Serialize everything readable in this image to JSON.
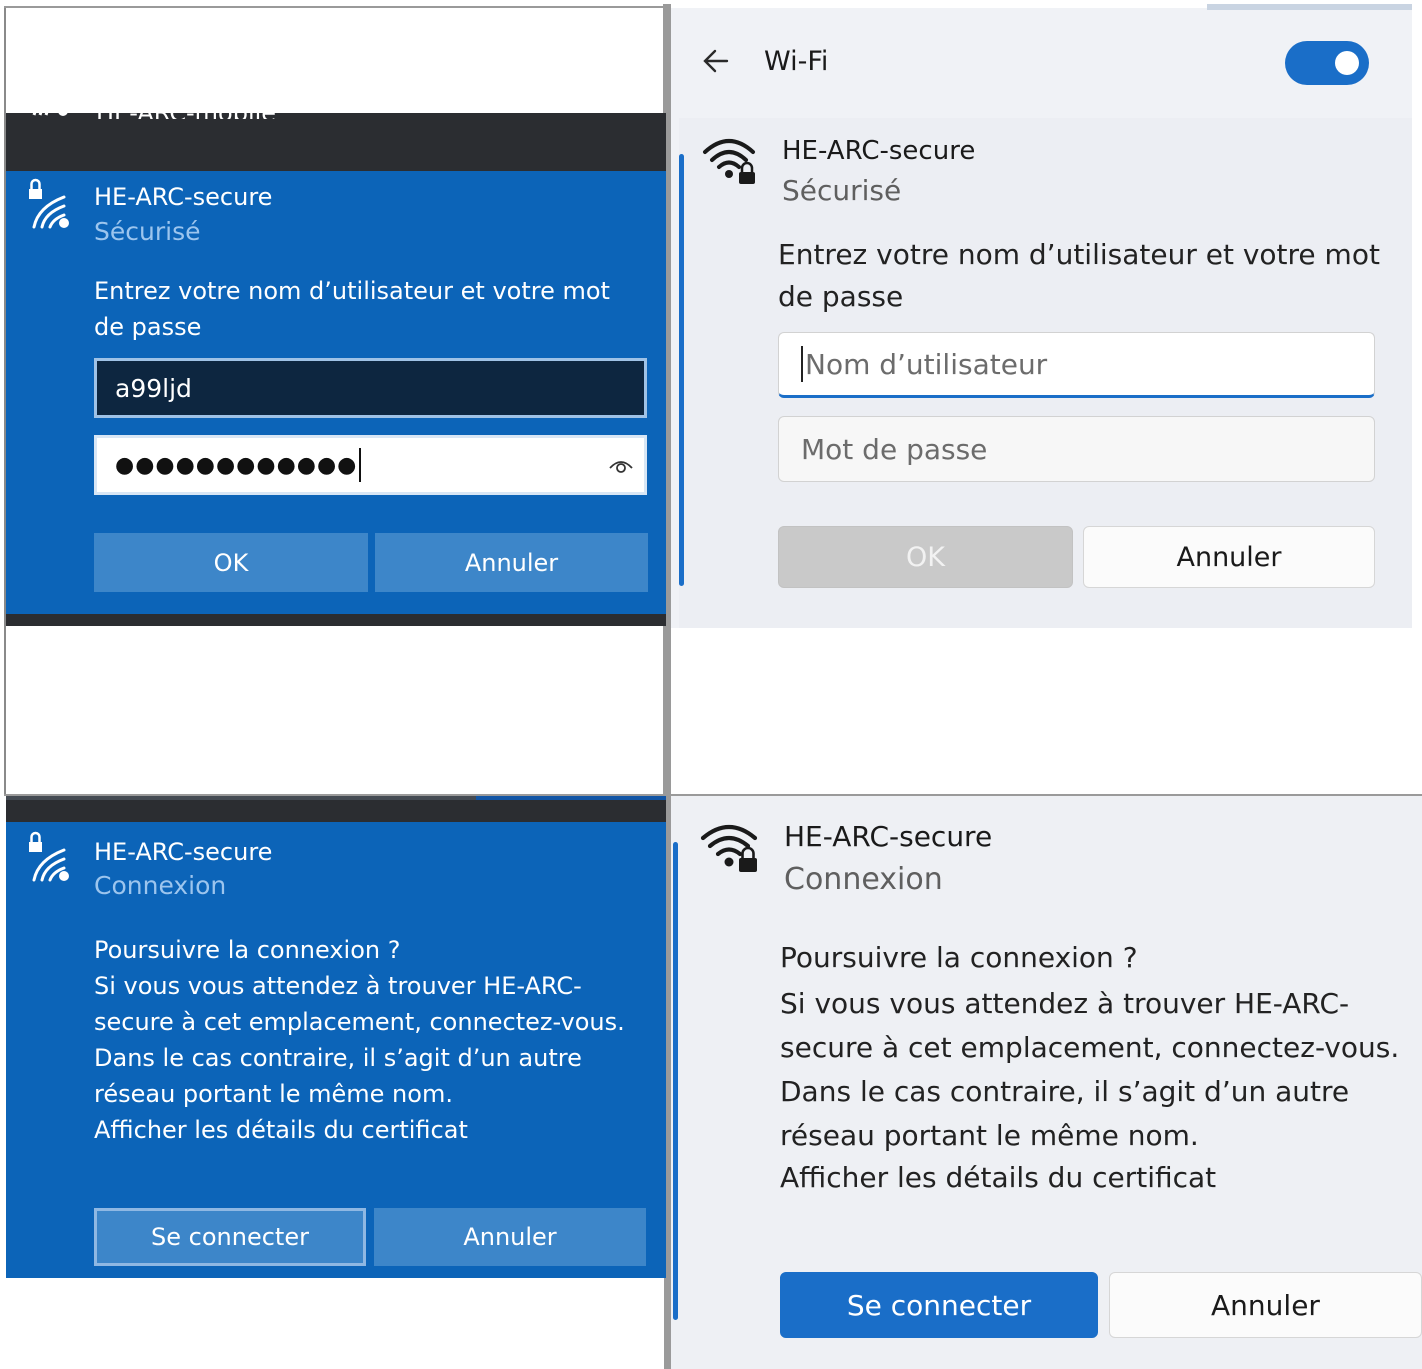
{
  "q1": {
    "peek_text": "HE-ARC-mobile",
    "network_name": "HE-ARC-secure",
    "network_status": "Sécurisé",
    "prompt": "Entrez votre nom d’utilisateur et votre mot de passe",
    "username_value": "a99ljd",
    "password_value": "●●●●●●●●●●●●",
    "ok_label": "OK",
    "cancel_label": "Annuler"
  },
  "q2": {
    "title": "Wi-Fi",
    "wifi_toggle_on": true,
    "network_name": "HE-ARC-secure",
    "network_status": "Sécurisé",
    "prompt": "Entrez votre nom d’utilisateur et votre mot de passe",
    "username_placeholder": "Nom d’utilisateur",
    "password_placeholder": "Mot de passe",
    "ok_label": "OK",
    "cancel_label": "Annuler"
  },
  "q3": {
    "network_name": "HE-ARC-secure",
    "network_status": "Connexion",
    "question": "Poursuivre la connexion ?",
    "body": "Si vous vous attendez à trouver HE-ARC-secure à cet emplacement, connectez-vous. Dans le cas contraire, il s’agit d’un autre réseau portant le même nom.",
    "cert_link": "Afficher les détails du certificat",
    "connect_label": "Se connecter",
    "cancel_label": "Annuler"
  },
  "q4": {
    "network_name": "HE-ARC-secure",
    "network_status": "Connexion",
    "question": "Poursuivre la connexion ?",
    "body": "Si vous vous attendez à trouver HE-ARC-secure à cet emplacement, connectez-vous. Dans le cas contraire, il s’agit d’un autre réseau portant le même nom.",
    "cert_link": "Afficher les détails du certificat",
    "connect_label": "Se connecter",
    "cancel_label": "Annuler"
  },
  "colors": {
    "w10_blue": "#0c64b8",
    "w10_button": "#3d86c9",
    "w11_accent": "#1a6ec8",
    "w11_background": "#eef0f5"
  }
}
